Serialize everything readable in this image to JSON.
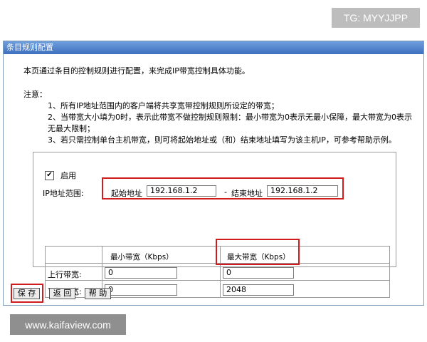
{
  "watermarks": {
    "top": "TG: MYYJJPP",
    "bottom": "www.kaifaview.com"
  },
  "panel": {
    "title": "条目规则配置",
    "intro": "本页通过条目的控制规则进行配置，来完成IP带宽控制具体功能。",
    "note_heading": "注意：",
    "notes": [
      "1、所有IP地址范围内的客户端将共享宽带控制规则所设定的带宽；",
      "2、当带宽大小填为0时，表示此带宽不做控制规则限制：最小带宽为0表示无最小保障，最大带宽为0表示",
      "无最大限制；",
      "3、若只需控制单台主机带宽，则可将起始地址或（和）结束地址填写为该主机IP，可参考帮助示例。"
    ]
  },
  "form": {
    "enable": {
      "label": "启用",
      "checked_mark": "✔"
    },
    "ip_range": {
      "label": "IP地址范围:",
      "start_label": "起始地址",
      "start_value": "192.168.1.2",
      "separator": "-",
      "end_label": "结束地址",
      "end_value": "192.168.1.2"
    },
    "bandwidth": {
      "headers": [
        "最小带宽（Kbps）",
        "最大带宽（Kbps）"
      ],
      "rows": [
        {
          "label": "上行带宽:",
          "min": "0",
          "max": "0"
        },
        {
          "label": "下行带宽:",
          "min": "0",
          "max": "2048"
        }
      ]
    }
  },
  "buttons": {
    "save": "保 存",
    "back": "返 回",
    "help": "帮 助"
  },
  "colors": {
    "title_bar": "#4a7cc9",
    "highlight": "#d01c1c",
    "border": "#9a9a9a"
  }
}
